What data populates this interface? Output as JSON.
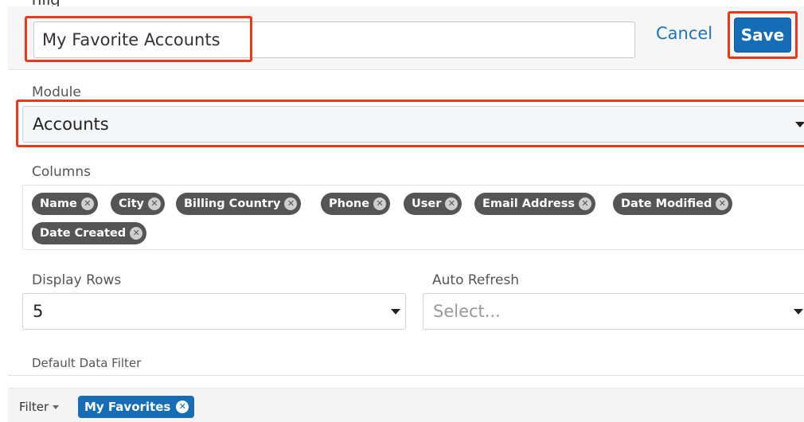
{
  "top_cropped_text": "nfig",
  "header": {
    "title_value": "My Favorite Accounts",
    "cancel_label": "Cancel",
    "save_label": "Save"
  },
  "module": {
    "label": "Module",
    "value": "Accounts"
  },
  "columns": {
    "label": "Columns",
    "pills": [
      "Name",
      "City",
      "Billing Country",
      "Phone",
      "User",
      "Email Address",
      "Date Modified",
      "Date Created"
    ]
  },
  "display_rows": {
    "label": "Display Rows",
    "value": "5"
  },
  "auto_refresh": {
    "label": "Auto Refresh",
    "placeholder": "Select..."
  },
  "default_filter": {
    "label": "Default Data Filter",
    "filter_label": "Filter",
    "active_filter": "My Favorites"
  },
  "colors": {
    "highlight": "#e8391a",
    "primary": "#176db5",
    "pill": "#555555"
  },
  "icons": {
    "remove": "remove-x-icon",
    "dropdown": "caret-down-icon"
  }
}
